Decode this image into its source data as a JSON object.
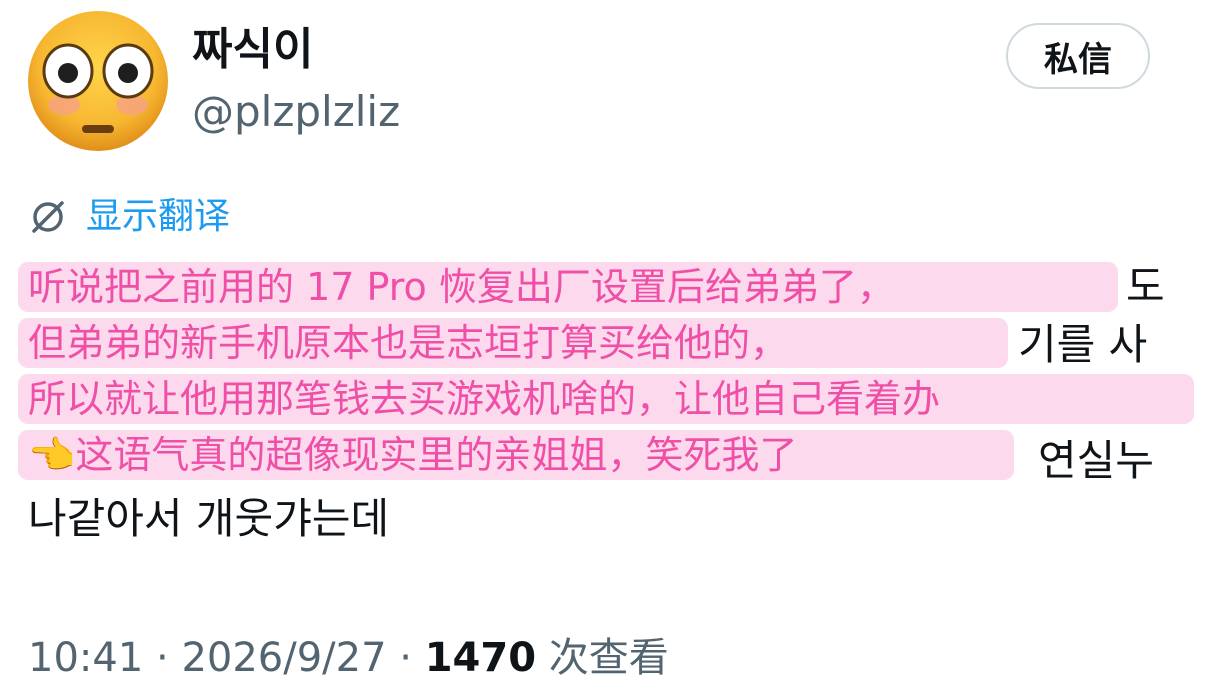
{
  "author": {
    "display_name": "짜식이",
    "handle": "@plzplzliz",
    "avatar_icon": "flushed-face-emoji"
  },
  "actions": {
    "dm_label": "私信"
  },
  "translate": {
    "icon": "no-translate-icon",
    "label": "显示翻译"
  },
  "post": {
    "korean_fragments": {
      "line1_tail": "도",
      "line2_tail": "기를 사",
      "line4_tail": "연실누",
      "line5": "나같아서 개웃갸는데"
    },
    "chinese_overlay": [
      "听说把之前用的 17 Pro 恢复出厂设置后给弟弟了，",
      "但弟弟的新手机原本也是志垣打算买给他的，",
      "所以就让他用那笔钱去买游戏机啥的，让他自己看着办",
      "👈这语气真的超像现实里的亲姐姐，笑死我了"
    ]
  },
  "meta": {
    "time": "10:41",
    "separator": " · ",
    "date": "2026/9/27",
    "views_count": "1470",
    "views_label": " 次查看"
  },
  "colors": {
    "link_blue": "#1d9bf0",
    "secondary_gray": "#536471",
    "overlay_bg": "#fcd9ec",
    "overlay_text": "#ef4fa6"
  }
}
